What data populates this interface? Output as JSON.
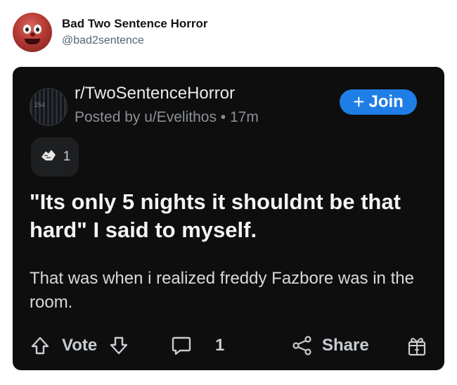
{
  "tweet": {
    "display_name": "Bad Two Sentence Horror",
    "handle": "@bad2sentence"
  },
  "post": {
    "subreddit": "r/TwoSentenceHorror",
    "posted_by": "Posted by u/Evelithos • 17m",
    "join_label": "Join",
    "award_count": "1",
    "title": "\"Its only 5 nights it shouldnt be that hard\" I said to myself.",
    "body": "That was when i realized freddy Fazbore was in the room.",
    "actions": {
      "vote_label": "Vote",
      "comment_count": "1",
      "share_label": "Share"
    }
  },
  "colors": {
    "card_background": "#0e0e0f",
    "join_button": "#1f7ee6",
    "handle_text": "#536471"
  },
  "icons": [
    "up-arrow-icon",
    "down-arrow-icon",
    "comment-icon",
    "share-icon",
    "gift-icon",
    "award-icon",
    "plus-icon"
  ]
}
